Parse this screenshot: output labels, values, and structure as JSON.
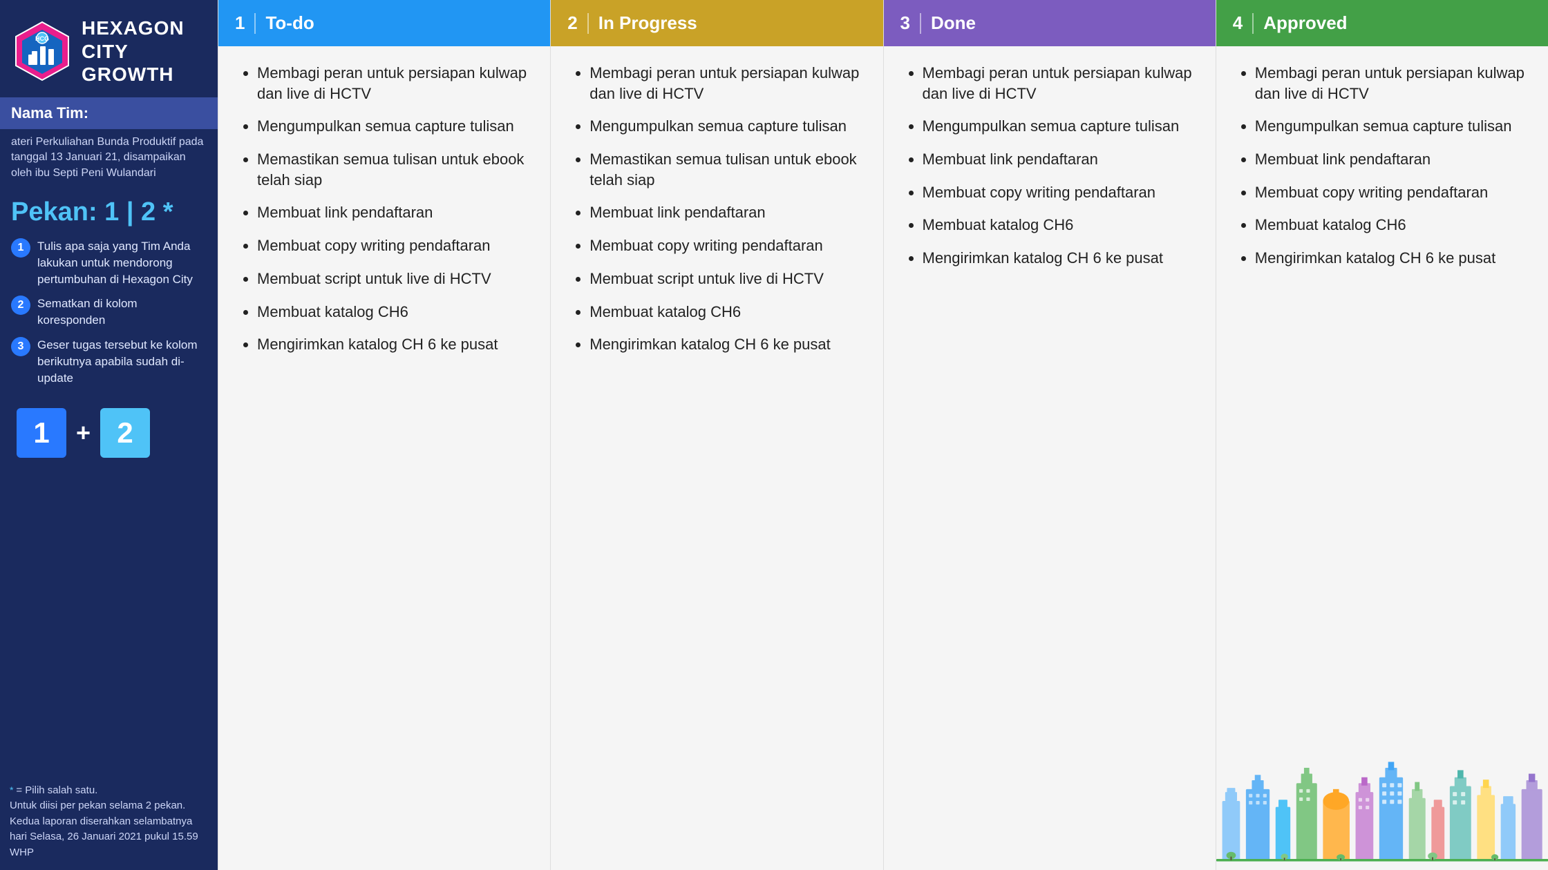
{
  "sidebar": {
    "title": "Hexagon City\nGrowth",
    "nama_tim_label": "Nama Tim:",
    "info_text": "ateri Perkuliahan Bunda Produktif pada tanggal 13 Januari\n21, disampaikan oleh ibu Septi Peni Wulandari",
    "pekan_label": "Pekan: 1 | 2",
    "pekan_asterisk": "*",
    "instructions": [
      {
        "number": "1",
        "text": "Tulis apa saja yang Tim Anda lakukan untuk mendorong pertumbuhan di Hexagon City"
      },
      {
        "number": "2",
        "text": "Sematkan di kolom koresponden"
      },
      {
        "number": "3",
        "text": "Geser tugas tersebut ke kolom berikutnya apabila sudah di-update"
      }
    ],
    "pekan_boxes": [
      "1",
      "2"
    ],
    "footnote_asterisk": "*",
    "footnote_line1": "= Pilih salah satu.",
    "footnote_line2": "Untuk diisi per pekan selama 2 pekan.",
    "footnote_line3": "Kedua laporan diserahkan selambatnya hari Selasa, 26 Januari 2021 pukul 15.59 WHP"
  },
  "columns": [
    {
      "id": "todo",
      "number": "1",
      "title": "To-do",
      "color": "#2196f3",
      "tasks": [
        "Membagi peran untuk persiapan kulwap dan live di HCTV",
        "Mengumpulkan semua capture tulisan",
        "Memastikan semua tulisan untuk ebook telah siap",
        "Membuat link pendaftaran",
        "Membuat copy writing pendaftaran",
        "Membuat script untuk live di HCTV",
        "Membuat katalog CH6",
        "Mengirimkan katalog CH 6 ke pusat"
      ]
    },
    {
      "id": "inprogress",
      "number": "2",
      "title": "In Progress",
      "color": "#c9a227",
      "tasks": [
        "Membagi peran untuk persiapan kulwap dan live di HCTV",
        "Mengumpulkan semua capture tulisan",
        "Memastikan semua tulisan untuk ebook telah siap",
        "Membuat link pendaftaran",
        "Membuat copy writing pendaftaran",
        "Membuat script untuk live di HCTV",
        "Membuat katalog CH6",
        "Mengirimkan katalog CH 6 ke pusat"
      ]
    },
    {
      "id": "done",
      "number": "3",
      "title": "Done",
      "color": "#7c5cbf",
      "tasks": [
        "Membagi peran untuk persiapan kulwap dan live di HCTV",
        "Mengumpulkan semua capture tulisan",
        "Membuat link pendaftaran",
        "Membuat copy writing pendaftaran",
        "Membuat katalog CH6",
        "Mengirimkan katalog CH 6 ke pusat"
      ]
    },
    {
      "id": "approved",
      "number": "4",
      "title": "Approved",
      "color": "#43a047",
      "tasks": [
        "Membagi peran untuk persiapan kulwap dan live di HCTV",
        "Mengumpulkan semua capture tulisan",
        "Membuat link pendaftaran",
        "Membuat copy writing pendaftaran",
        "Membuat katalog CH6",
        "Mengirimkan katalog CH 6 ke pusat"
      ]
    }
  ]
}
